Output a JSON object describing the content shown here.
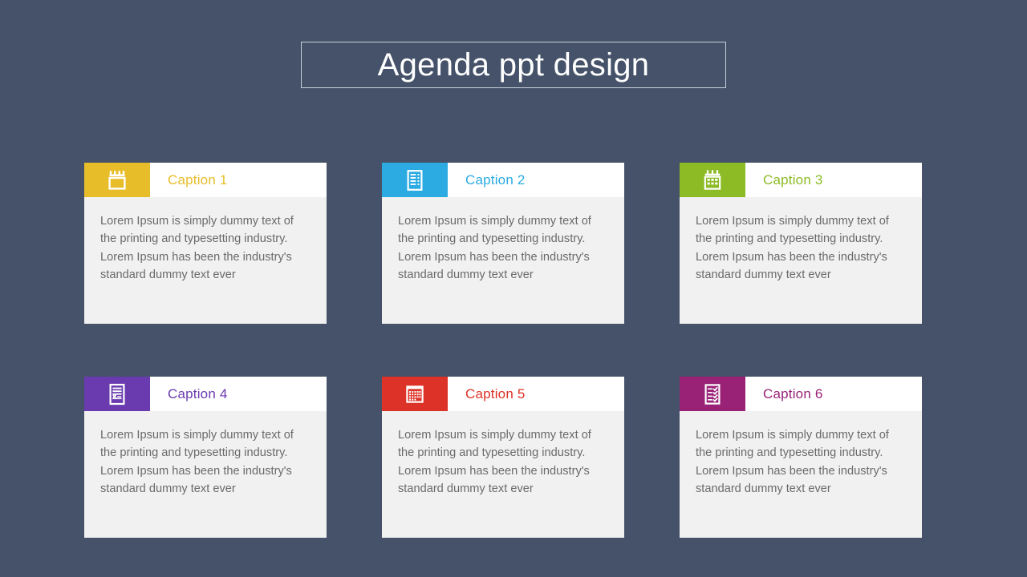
{
  "slide": {
    "background_color": "#455269",
    "title": "Agenda ppt design",
    "title_border_color": "#c9cfdb",
    "title_color": "#ffffff"
  },
  "body_paragraph": "Lorem Ipsum is simply dummy text of the printing and typesetting industry. Lorem Ipsum has been the industry's standard dummy text ever",
  "cards": [
    {
      "caption": "Caption  1",
      "color": "#e8bd2a",
      "icon": "calendar-icon",
      "body": "Lorem Ipsum is simply dummy text of the printing and typesetting industry. Lorem Ipsum has been the industry's standard dummy text ever"
    },
    {
      "caption": "Caption  2",
      "color": "#2babe2",
      "icon": "document-list-icon",
      "body": "Lorem Ipsum is simply dummy text of the printing and typesetting industry. Lorem Ipsum has been the industry's standard dummy text ever"
    },
    {
      "caption": "Caption  3",
      "color": "#8cbb26",
      "icon": "calendar-grid-icon",
      "body": "Lorem Ipsum is simply dummy text of the printing and typesetting industry. Lorem Ipsum has been the industry's standard dummy text ever"
    },
    {
      "caption": "Caption  4",
      "color": "#6a3aaf",
      "icon": "signed-document-icon",
      "body": "Lorem Ipsum is simply dummy text of the printing and typesetting industry. Lorem Ipsum has been the industry's standard dummy text ever"
    },
    {
      "caption": "Caption  5",
      "color": "#dd3227",
      "icon": "calendar-dense-grid-icon",
      "body": "Lorem Ipsum is simply dummy text of the printing and typesetting industry. Lorem Ipsum has been the industry's standard dummy text ever"
    },
    {
      "caption": "Caption  6",
      "color": "#992277",
      "icon": "checklist-icon",
      "body": "Lorem Ipsum is simply dummy text of the printing and typesetting industry. Lorem Ipsum has been the industry's standard dummy text ever"
    }
  ]
}
